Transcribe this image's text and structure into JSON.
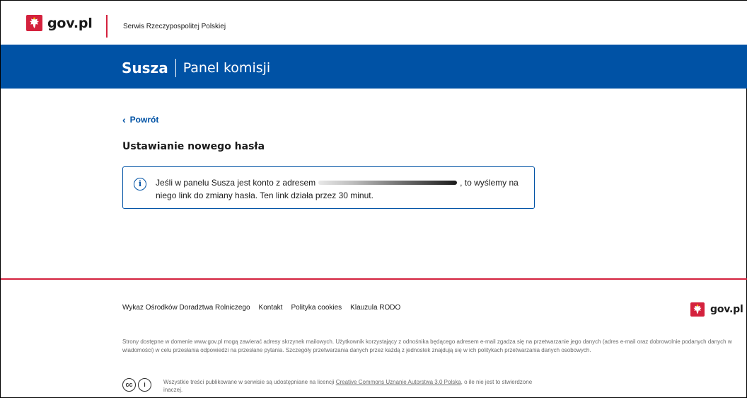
{
  "topbar": {
    "logo_text": "gov.pl",
    "serwis": "Serwis Rzeczypospolitej Polskiej"
  },
  "header": {
    "app_name": "Susza",
    "panel_name": "Panel komisji",
    "color": "#0052a5"
  },
  "main": {
    "back_label": "Powrót",
    "title": "Ustawianie nowego hasła",
    "alert": {
      "before": "Jeśli w panelu Susza jest konto z adresem",
      "after": ", to wyślemy na niego link do zmiany hasła. Ten link działa przez 30 minut."
    }
  },
  "footer": {
    "links": [
      "Wykaz Ośrodków Doradztwa Rolniczego",
      "Kontakt",
      "Polityka cookies",
      "Klauzula RODO"
    ],
    "logo_text": "gov.pl",
    "disclaimer": "Strony dostępne w domenie www.gov.pl mogą zawierać adresy skrzynek mailowych. Użytkownik korzystający z odnośnika będącego adresem e-mail zgadza się na przetwarzanie jego danych (adres e-mail oraz dobrowolnie podanych danych w wiadomości) w celu przesłania odpowiedzi na przesłane pytania. Szczegóły przetwarzania danych przez każdą z jednostek znajdują się w ich politykach przetwarzania danych osobowych.",
    "license_before": "Wszystkie treści publikowane w serwisie są udostępniane na licencji",
    "license_link": "Creative Commons Uznanie Autorstwa 3.0 Polska",
    "license_after": ", o ile nie jest to stwierdzone inaczej.",
    "cc_icon_1": "cc",
    "cc_icon_2": "i"
  },
  "colors": {
    "accent_red": "#d4213d",
    "brand_blue": "#0052a5"
  }
}
